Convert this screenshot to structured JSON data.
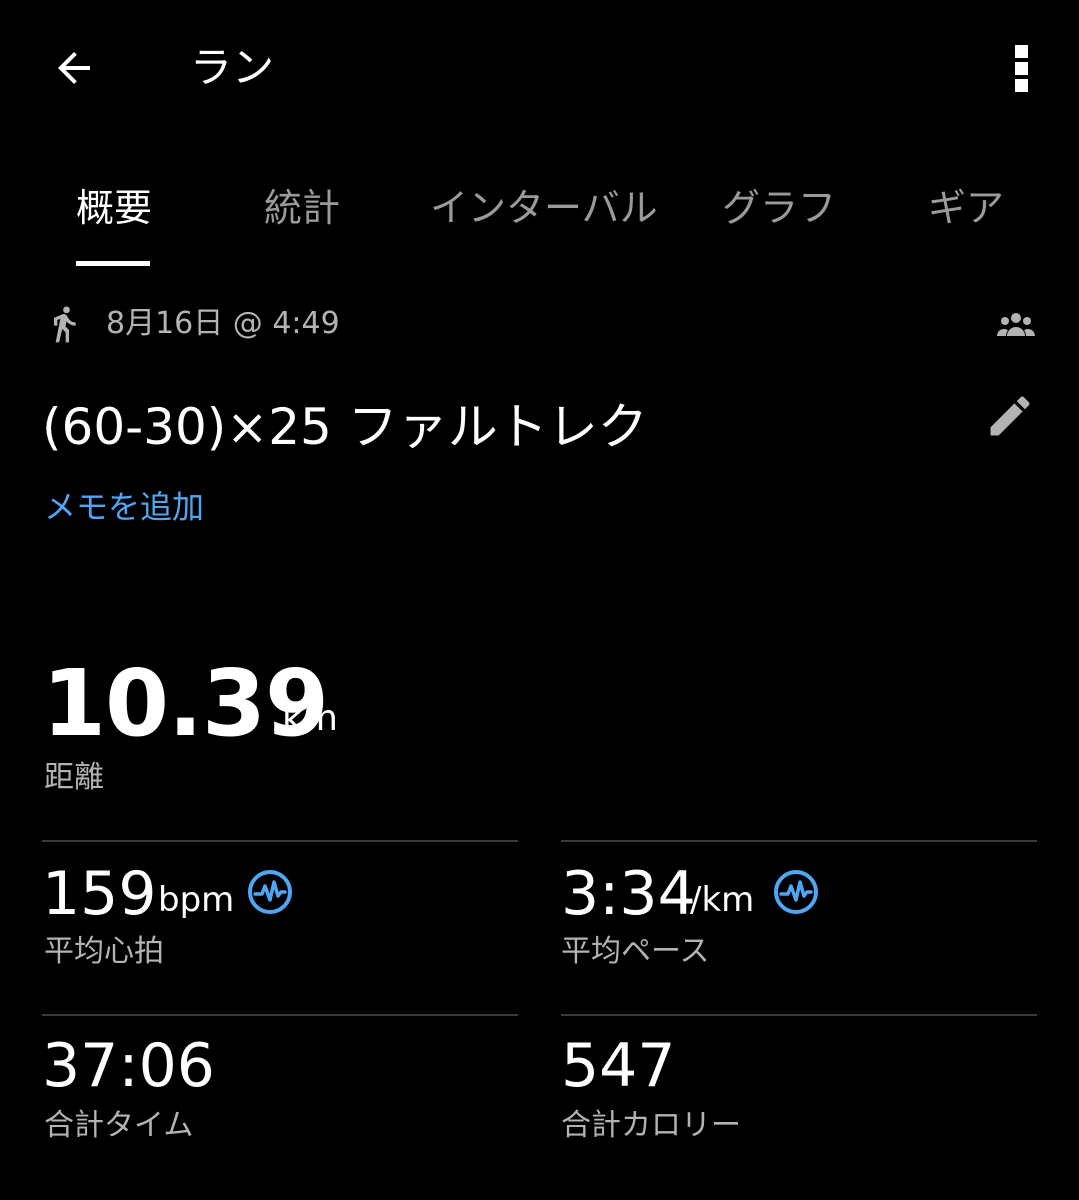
{
  "header": {
    "title": "ラン"
  },
  "tabs": [
    {
      "label": "概要",
      "active": true
    },
    {
      "label": "統計",
      "active": false
    },
    {
      "label": "インターバル",
      "active": false
    },
    {
      "label": "グラフ",
      "active": false
    },
    {
      "label": "ギア",
      "active": false
    }
  ],
  "activity": {
    "date": "8月16日 @ 4:49",
    "name": "(60-30)×25 ファルトレク",
    "add_memo_label": "メモを追加"
  },
  "distance": {
    "value": "10.39",
    "unit": "km",
    "label": "距離"
  },
  "stats": {
    "heart_rate": {
      "value": "159",
      "unit": "bpm",
      "label": "平均心拍"
    },
    "pace": {
      "value": "3:34",
      "unit": "/km",
      "label": "平均ペース"
    },
    "total_time": {
      "value": "37:06",
      "label": "合計タイム"
    },
    "calories": {
      "value": "547",
      "label": "合計カロリー"
    }
  },
  "colors": {
    "background": "#000000",
    "accent_link": "#4ea6f5",
    "secondary_text": "#b3b3b3",
    "inactive_tab": "#9a9a9a",
    "divider": "#3a3a3a"
  },
  "icons": {
    "back": "arrow-left-icon",
    "more": "more-vertical-icon",
    "activity_type": "running-person-icon",
    "privacy": "group-icon",
    "edit": "pencil-icon",
    "sensor": "heart-wave-icon"
  }
}
